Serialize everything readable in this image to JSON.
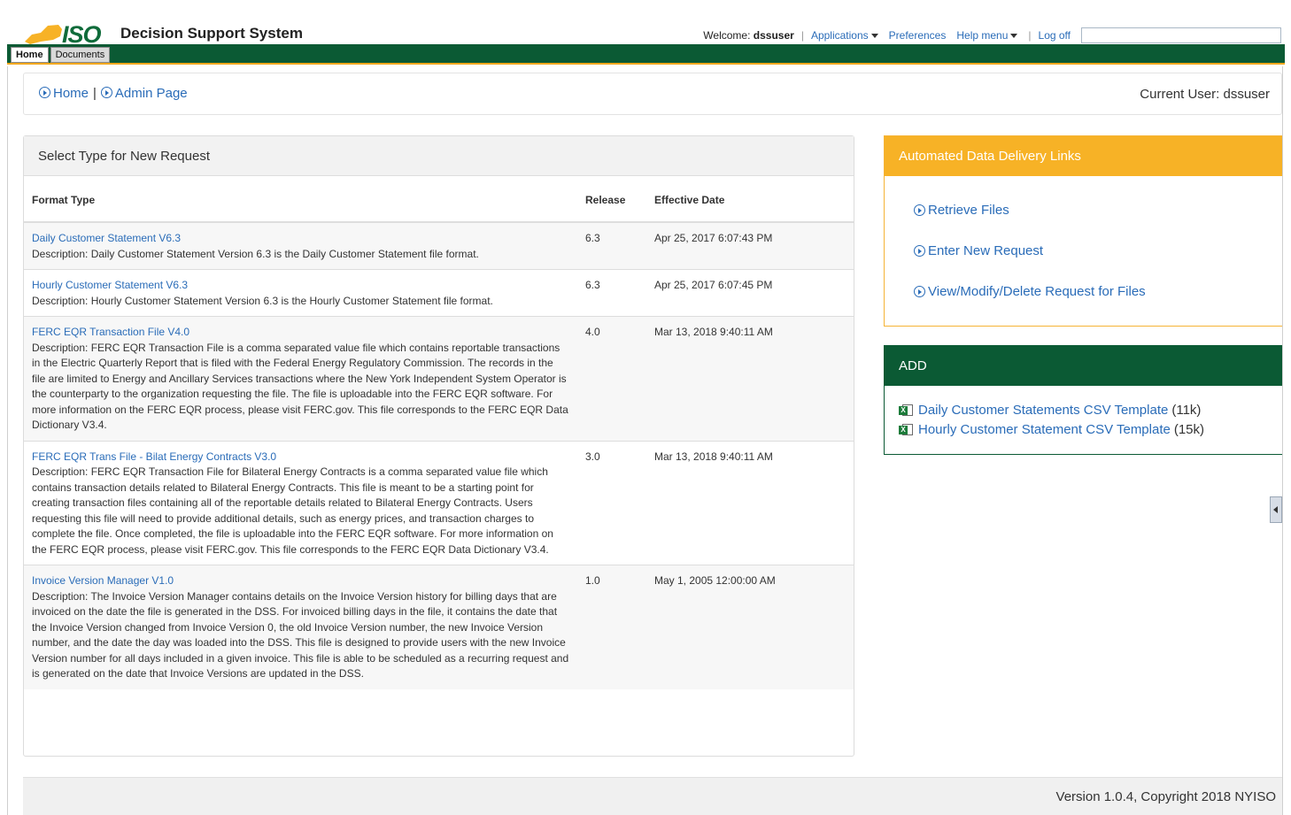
{
  "header": {
    "logo_text": "ISO",
    "app_title": "Decision Support System",
    "welcome_label": "Welcome:",
    "username": "dssuser",
    "menu": {
      "applications": "Applications",
      "preferences": "Preferences",
      "help": "Help menu",
      "logoff": "Log off"
    },
    "search_value": ""
  },
  "tabs": [
    {
      "label": "Home",
      "active": true
    },
    {
      "label": "Documents",
      "active": false
    }
  ],
  "breadcrumb": {
    "home": "Home",
    "separator": "|",
    "admin": "Admin Page",
    "current_user": "Current User: dssuser"
  },
  "request_panel": {
    "title": "Select Type for New Request",
    "columns": [
      "Format Type",
      "Release",
      "Effective Date"
    ],
    "rows": [
      {
        "name": "Daily Customer Statement V6.3",
        "description": "Description: Daily Customer Statement Version 6.3 is the Daily Customer Statement file format.",
        "release": "6.3",
        "effective_date": "Apr 25, 2017 6:07:43 PM"
      },
      {
        "name": "Hourly Customer Statement V6.3",
        "description": "Description: Hourly Customer Statement Version 6.3 is the Hourly Customer Statement file format.",
        "release": "6.3",
        "effective_date": "Apr 25, 2017 6:07:45 PM"
      },
      {
        "name": "FERC EQR Transaction File V4.0",
        "description": "Description: FERC EQR Transaction File is a comma separated value file which contains reportable transactions in the Electric Quarterly Report that is filed with the Federal Energy Regulatory Commission. The records in the file are limited to Energy and Ancillary Services transactions where the New York Independent System Operator is the counterparty to the organization requesting the file. The file is uploadable into the FERC EQR software. For more information on the FERC EQR process, please visit FERC.gov. This file corresponds to the FERC EQR Data Dictionary V3.4.",
        "release": "4.0",
        "effective_date": "Mar 13, 2018 9:40:11 AM"
      },
      {
        "name": "FERC EQR Trans File - Bilat Energy Contracts V3.0",
        "description": "Description: FERC EQR Transaction File for Bilateral Energy Contracts is a comma separated value file which contains transaction details related to Bilateral Energy Contracts. This file is meant to be a starting point for creating transaction files containing all of the reportable details related to Bilateral Energy Contracts. Users requesting this file will need to provide additional details, such as energy prices, and transaction charges to complete the file. Once completed, the file is uploadable into the FERC EQR software. For more information on the FERC EQR process, please visit FERC.gov. This file corresponds to the FERC EQR Data Dictionary V3.4.",
        "release": "3.0",
        "effective_date": "Mar 13, 2018 9:40:11 AM"
      },
      {
        "name": "Invoice Version Manager V1.0",
        "description": "Description: The Invoice Version Manager contains details on the Invoice Version history for billing days that are invoiced on the date the file is generated in the DSS. For invoiced billing days in the file, it contains the date that the Invoice Version changed from Invoice Version 0, the old Invoice Version number, the new Invoice Version number, and the date the day was loaded into the DSS. This file is designed to provide users with the new Invoice Version number for all days included in a given invoice. This file is able to be scheduled as a recurring request and is generated on the date that Invoice Versions are updated in the DSS.",
        "release": "1.0",
        "effective_date": "May 1, 2005 12:00:00 AM"
      }
    ]
  },
  "automated_panel": {
    "title": "Automated Data Delivery Links",
    "links": [
      "Retrieve Files",
      "Enter New Request",
      "View/Modify/Delete Request for Files"
    ]
  },
  "add_panel": {
    "title": "ADD",
    "templates": [
      {
        "label": "Daily Customer Statements CSV Template",
        "size": "(11k)"
      },
      {
        "label": "Hourly Customer Statement CSV Template",
        "size": "(15k)"
      }
    ]
  },
  "footer": {
    "text": "Version 1.0.4, Copyright 2018 NYISO"
  },
  "colors": {
    "green": "#0b5a34",
    "orange": "#f7b226",
    "link": "#2a6cb8"
  }
}
